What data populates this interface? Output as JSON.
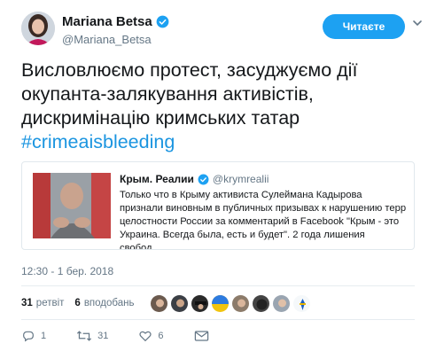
{
  "author": {
    "display_name": "Mariana Betsa",
    "handle": "@Mariana_Betsa",
    "verified": true
  },
  "follow_button": {
    "label": "Читаєте",
    "color": "#1da1f2"
  },
  "menu_icon": "chevron-down-icon",
  "tweet": {
    "text": "Висловлюємо протест, засуджуємо дії окупанта-залякування активістів, дискримінацію кримських татар",
    "hashtag": "#crimeaisbleeding",
    "hashtag_color": "#1b95e0"
  },
  "quoted": {
    "name": "Крым. Реалии",
    "handle": "@krymrealii",
    "verified": true,
    "text": "Только что в Крыму активиста Сулеймана Кадырова признали виновным в публичных призывах к нарушению терр целостности России за комментарий в Facebook \"Крым - это Украина. Всегда была, есть и будет\". 2 года лишения свобод…"
  },
  "timestamp": "12:30 - 1 бер. 2018",
  "stats": {
    "retweets_count": "31",
    "retweets_label": "ретвіт",
    "likes_count": "6",
    "likes_label": "вподобань",
    "liker_avatars": 8
  },
  "actions": {
    "reply_count": "1",
    "retweet_count": "31",
    "like_count": "6",
    "icons": [
      "reply-icon",
      "retweet-icon",
      "like-icon",
      "message-icon"
    ]
  }
}
